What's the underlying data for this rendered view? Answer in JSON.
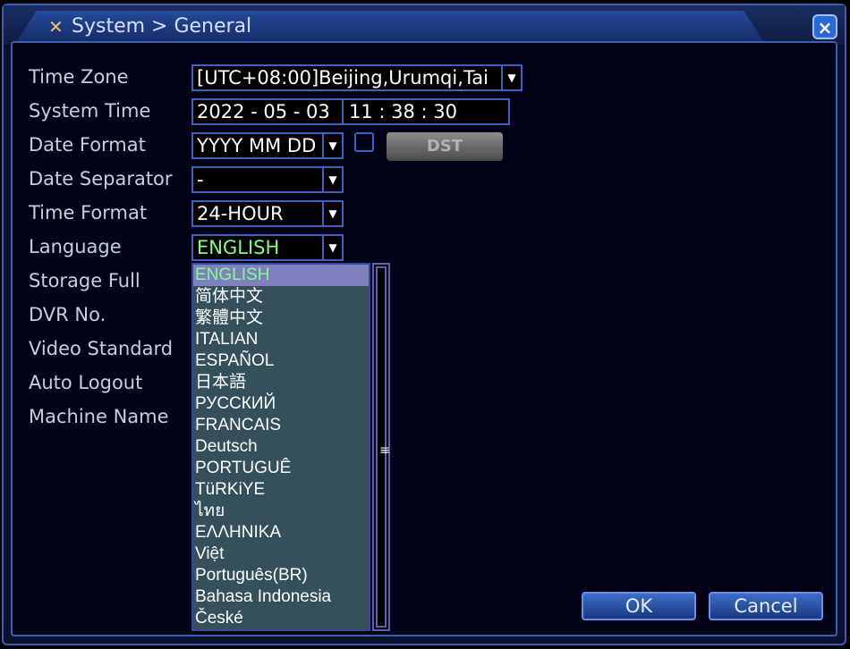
{
  "window": {
    "title": "System > General",
    "close_label": "×"
  },
  "form": {
    "time_zone": {
      "label": "Time Zone",
      "value": "[UTC+08:00]Beijing,Urumqi,Tai"
    },
    "system_time": {
      "label": "System Time",
      "date": "2022 - 05 - 03",
      "time": "11 : 38 : 30"
    },
    "date_format": {
      "label": "Date Format",
      "value": "YYYY MM DD"
    },
    "dst": {
      "label": "DST"
    },
    "date_separator": {
      "label": "Date Separator",
      "value": "-"
    },
    "time_format": {
      "label": "Time Format",
      "value": "24-HOUR"
    },
    "language": {
      "label": "Language",
      "value": "ENGLISH"
    },
    "storage_full": {
      "label": "Storage Full"
    },
    "dvr_no": {
      "label": "DVR No."
    },
    "video_standard": {
      "label": "Video Standard"
    },
    "auto_logout": {
      "label": "Auto Logout"
    },
    "machine_name": {
      "label": "Machine Name"
    }
  },
  "language_options": [
    "ENGLISH",
    "简体中文",
    "繁體中文",
    "ITALIAN",
    "ESPAÑOL",
    "日本語",
    "РУССКИЙ",
    "FRANCAIS",
    "Deutsch",
    "PORTUGUÊ",
    "TüRKiYE",
    "ไทย",
    "ΕΛΛΗΝΙΚΑ",
    "Việt",
    "Português(BR)",
    "Bahasa Indonesia",
    "České"
  ],
  "buttons": {
    "ok": "OK",
    "cancel": "Cancel"
  },
  "colors": {
    "accent": "#3d63c2",
    "selected_text": "#80ff80"
  }
}
